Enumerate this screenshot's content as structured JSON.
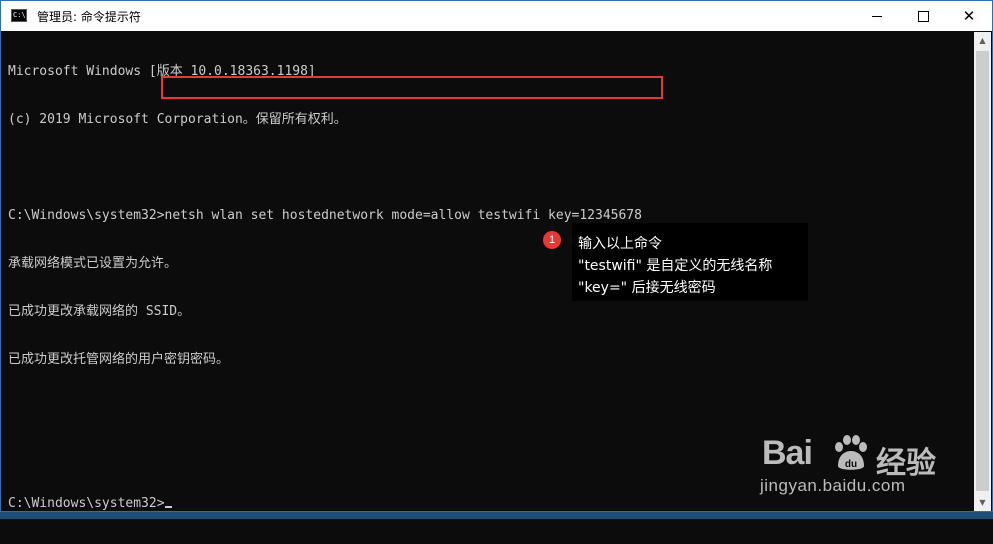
{
  "window": {
    "title": "管理员: 命令提示符",
    "icon": "cmd-icon",
    "controls": {
      "minimize_icon": "minimize-icon",
      "maximize_icon": "maximize-icon",
      "close_glyph": "✕"
    }
  },
  "console": {
    "lines": [
      "Microsoft Windows [版本 10.0.18363.1198]",
      "(c) 2019 Microsoft Corporation。保留所有权利。",
      "",
      "C:\\Windows\\system32>netsh wlan set hostednetwork mode=allow testwifi key=12345678",
      "承载网络模式已设置为允许。",
      "已成功更改承载网络的 SSID。",
      "已成功更改托管网络的用户密钥密码。",
      "",
      "",
      "C:\\Windows\\system32>"
    ]
  },
  "annotation": {
    "step_number": "1",
    "lines": [
      "输入以上命令",
      "\"testwifi\" 是自定义的无线名称",
      "\"key=\" 后接无线密码"
    ],
    "highlight_color": "#e53935"
  },
  "watermark": {
    "logo": "Bai",
    "logo_suffix": "du",
    "brand": "经验",
    "url": "jingyan.baidu.com"
  },
  "colors": {
    "console_bg": "#0c0c0c",
    "console_text": "#cccccc",
    "titlebar_bg": "#ffffff"
  }
}
